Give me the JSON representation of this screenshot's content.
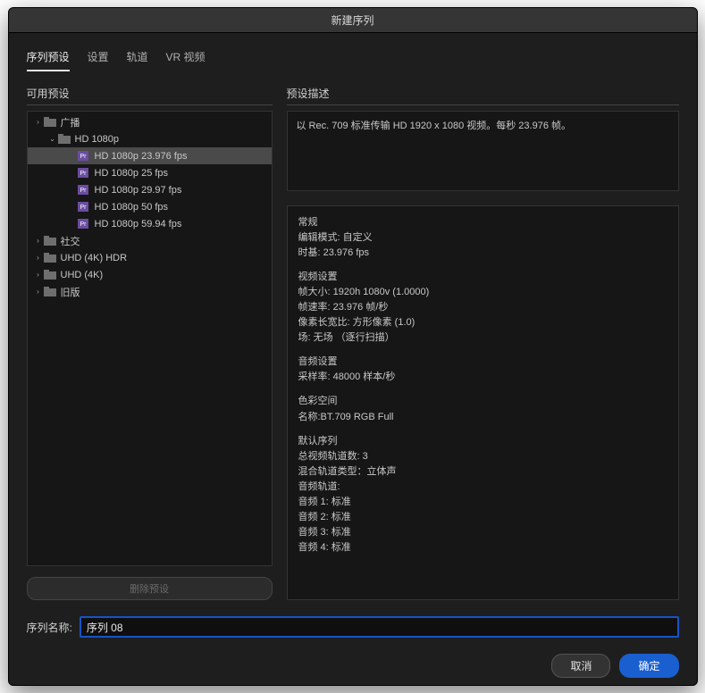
{
  "title": "新建序列",
  "tabs": {
    "presets": "序列预设",
    "settings": "设置",
    "tracks": "轨道",
    "vr": "VR 视频"
  },
  "available_label": "可用预设",
  "description_label": "预设描述",
  "tree": {
    "broadcast": "广播",
    "hd1080p": "HD 1080p",
    "p23976": "HD 1080p 23.976 fps",
    "p25": "HD 1080p 25 fps",
    "p2997": "HD 1080p 29.97 fps",
    "p50": "HD 1080p 50 fps",
    "p5994": "HD 1080p 59.94 fps",
    "social": "社交",
    "uhd_hdr": "UHD (4K) HDR",
    "uhd": "UHD (4K)",
    "legacy": "旧版"
  },
  "delete_preset": "删除预设",
  "description_text": "以 Rec. 709 标准传输 HD 1920 x 1080 视频。每秒 23.976 帧。",
  "details": {
    "general_h": "常规",
    "edit_mode": "编辑模式: 自定义",
    "timebase": "时基: 23.976 fps",
    "video_h": "视频设置",
    "frame_size": "帧大小: 1920h 1080v (1.0000)",
    "frame_rate": "帧速率: 23.976  帧/秒",
    "px_aspect": "像素长宽比: 方形像素 (1.0)",
    "fields": "场: 无场 （逐行扫描）",
    "audio_h": "音频设置",
    "sample_rate": "采样率: 48000 样本/秒",
    "color_h": "色彩空间",
    "color_name": "名称:BT.709 RGB Full",
    "seq_h": "默认序列",
    "total_tracks": "总视频轨道数: 3",
    "mix_type": "混合轨道类型：立体声",
    "audio_tracks_h": "音频轨道:",
    "a1": "音频 1: 标准",
    "a2": "音频 2: 标准",
    "a3": "音频 3: 标准",
    "a4": "音频 4: 标准"
  },
  "seq_name_label": "序列名称:",
  "seq_name_value": "序列 08",
  "cancel": "取消",
  "ok": "确定"
}
